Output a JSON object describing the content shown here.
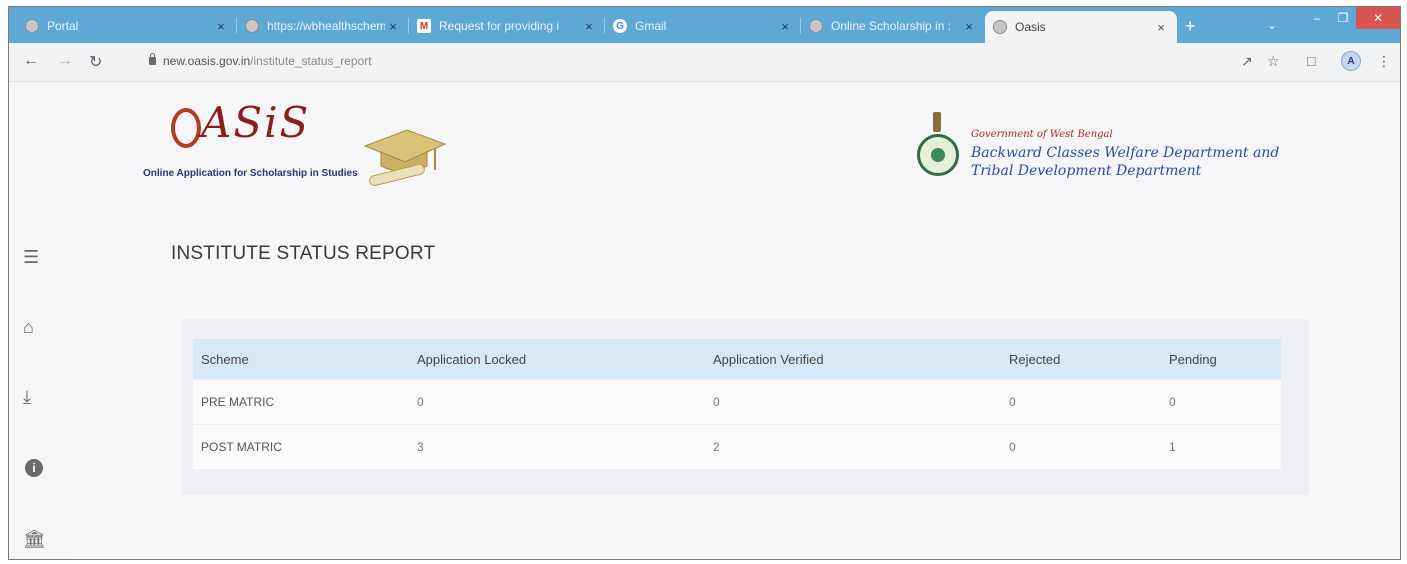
{
  "browser": {
    "tabs": [
      {
        "title": "Portal",
        "favicon": "globe-icon"
      },
      {
        "title": "https://wbhealthschem",
        "favicon": "globe-icon"
      },
      {
        "title": "Request for providing i",
        "favicon": "gmail-icon"
      },
      {
        "title": "Gmail",
        "favicon": "google-icon"
      },
      {
        "title": "Online Scholarship in :",
        "favicon": "globe-icon"
      },
      {
        "title": "Oasis",
        "favicon": "globe-icon",
        "active": true
      }
    ],
    "close_glyph": "×",
    "new_tab_glyph": "+",
    "url_host": "new.oasis.gov.in",
    "url_path": "/institute_status_report",
    "profile_initial": "A"
  },
  "header": {
    "logo_text": "ASiS",
    "logo_tagline": "Online Application for Scholarship in Studies",
    "gov_line1": "Government of West Bengal",
    "gov_line2": "Backward Classes Welfare Department and",
    "gov_line3": "Tribal Development Department"
  },
  "sidebar": {
    "items": [
      {
        "icon": "menu-icon"
      },
      {
        "icon": "home-icon"
      },
      {
        "icon": "download-icon"
      },
      {
        "icon": "info-icon"
      },
      {
        "icon": "bank-icon"
      }
    ]
  },
  "report": {
    "title": "INSTITUTE STATUS REPORT",
    "columns": [
      "Scheme",
      "Application Locked",
      "Application Verified",
      "Rejected",
      "Pending"
    ],
    "rows": [
      [
        "PRE MATRIC",
        "0",
        "0",
        "0",
        "0"
      ],
      [
        "POST MATRIC",
        "3",
        "2",
        "0",
        "1"
      ]
    ]
  },
  "colors": {
    "tabstrip": "#5ea8d6",
    "table_header": "#d7e9f7",
    "logo": "#8b1d1d",
    "gov_text": "#2b4aa3"
  }
}
